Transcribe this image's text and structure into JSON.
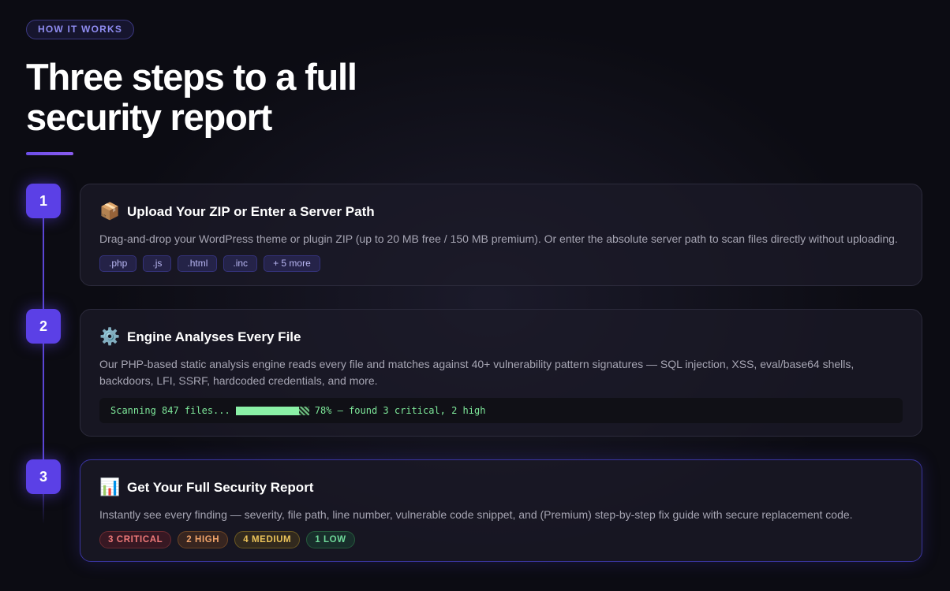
{
  "section": {
    "eyebrow": "HOW IT WORKS",
    "title_line1": "Three steps to a full",
    "title_line2": "security report"
  },
  "steps": [
    {
      "number": "1",
      "icon": "package-icon",
      "icon_glyph": "📦",
      "title": "Upload Your ZIP or Enter a Server Path",
      "description": "Drag-and-drop your WordPress theme or plugin ZIP (up to 20 MB free / 150 MB premium). Or enter the absolute server path to scan files directly without uploading.",
      "tags": [
        ".php",
        ".js",
        ".html",
        ".inc",
        "+ 5 more"
      ]
    },
    {
      "number": "2",
      "icon": "gear-icon",
      "icon_glyph": "⚙️",
      "title": "Engine Analyses Every File",
      "description": "Our PHP-based static analysis engine reads every file and matches against 40+ vulnerability pattern signatures — SQL injection, XSS, eval/base64 shells, backdoors, LFI, SSRF, hardcoded credentials, and more.",
      "terminal": {
        "prefix": "Scanning 847 files...",
        "progress_percent": 78,
        "suffix": "78% — found 3 critical, 2 high"
      }
    },
    {
      "number": "3",
      "icon": "bar-chart-icon",
      "icon_glyph": "📊",
      "title": "Get Your Full Security Report",
      "description": "Instantly see every finding — severity, file path, line number, vulnerable code snippet, and (Premium) step-by-step fix guide with secure replacement code.",
      "badges": [
        {
          "label": "3 CRITICAL",
          "level": "critical",
          "color": "#f07a7a"
        },
        {
          "label": "2 HIGH",
          "level": "high",
          "color": "#f0a36a"
        },
        {
          "label": "4 MEDIUM",
          "level": "medium",
          "color": "#ecc45a"
        },
        {
          "label": "1 LOW",
          "level": "low",
          "color": "#6fd89a"
        }
      ]
    }
  ],
  "colors": {
    "accent": "#5b40e6",
    "background": "#0c0c13",
    "terminal_text": "#7ee89a"
  }
}
